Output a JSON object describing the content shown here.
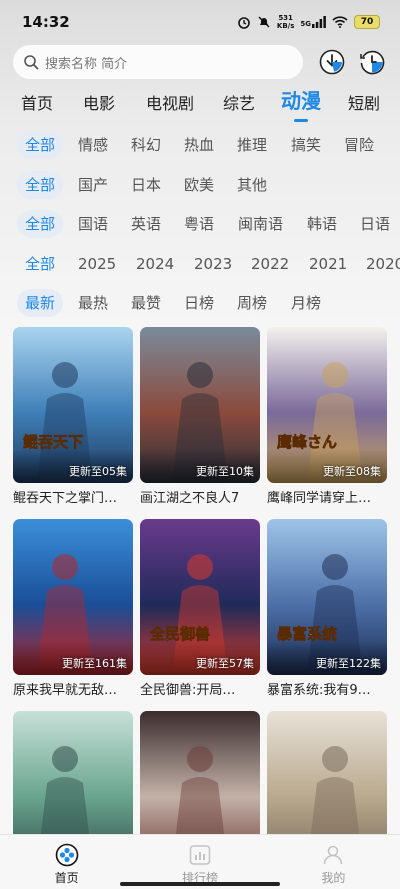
{
  "status": {
    "time": "14:32",
    "net_speed_value": "531",
    "net_speed_unit": "KB/s",
    "network": "5G",
    "battery": "70"
  },
  "search": {
    "placeholder": "搜索名称 简介"
  },
  "categories": [
    "首页",
    "电影",
    "电视剧",
    "综艺",
    "动漫",
    "短剧"
  ],
  "active_category": "动漫",
  "filters": {
    "genre": [
      "全部",
      "情感",
      "科幻",
      "热血",
      "推理",
      "搞笑",
      "冒险"
    ],
    "region": [
      "全部",
      "国产",
      "日本",
      "欧美",
      "其他"
    ],
    "language": [
      "全部",
      "国语",
      "英语",
      "粤语",
      "闽南语",
      "韩语",
      "日语"
    ],
    "year": [
      "全部",
      "2025",
      "2024",
      "2023",
      "2022",
      "2021",
      "2020"
    ],
    "sort": [
      "最新",
      "最热",
      "最赞",
      "日榜",
      "周榜",
      "月榜"
    ]
  },
  "items": [
    {
      "title": "鲲吞天下之掌门…",
      "episode": "更新至05集",
      "poster_logo": "鲲吞天下",
      "colors": [
        "#a9d4ef",
        "#3f7fb8",
        "#1f3b5f"
      ]
    },
    {
      "title": "画江湖之不良人7",
      "episode": "更新至10集",
      "poster_logo": "",
      "colors": [
        "#7a8b9b",
        "#8b4a3c",
        "#2a2f3a"
      ]
    },
    {
      "title": "鹰峰同学请穿上…",
      "episode": "更新至08集",
      "poster_logo": "鹰峰さん",
      "colors": [
        "#f4f1ec",
        "#7a6a9a",
        "#c9a25a"
      ]
    },
    {
      "title": "原来我早就无敌…",
      "episode": "更新至161集",
      "poster_logo": "",
      "colors": [
        "#3b8fd9",
        "#1b4e98",
        "#b5262a"
      ]
    },
    {
      "title": "全民御兽:开局…",
      "episode": "更新至57集",
      "poster_logo": "全民御兽",
      "colors": [
        "#6b3a8c",
        "#1f2a5a",
        "#d83a2a"
      ]
    },
    {
      "title": "暴富系统:我有9…",
      "episode": "更新至122集",
      "poster_logo": "暴富系统",
      "colors": [
        "#9fc4e8",
        "#4c6fa8",
        "#1e2f55"
      ]
    },
    {
      "title": "",
      "episode": "",
      "poster_logo": "",
      "colors": [
        "#c7e0d8",
        "#6aa58f",
        "#2f4f4a"
      ]
    },
    {
      "title": "",
      "episode": "",
      "poster_logo": "",
      "colors": [
        "#3a2d2d",
        "#c4b2a8",
        "#6b3d3a"
      ]
    },
    {
      "title": "",
      "episode": "",
      "poster_logo": "",
      "colors": [
        "#e8e2d8",
        "#b9a98e",
        "#7a6b5a"
      ]
    }
  ],
  "bottom_nav": [
    {
      "label": "首页",
      "icon": "home-icon",
      "active": true
    },
    {
      "label": "排行榜",
      "icon": "ranking-icon",
      "active": false
    },
    {
      "label": "我的",
      "icon": "profile-icon",
      "active": false
    }
  ],
  "accent_color": "#1e88e5"
}
